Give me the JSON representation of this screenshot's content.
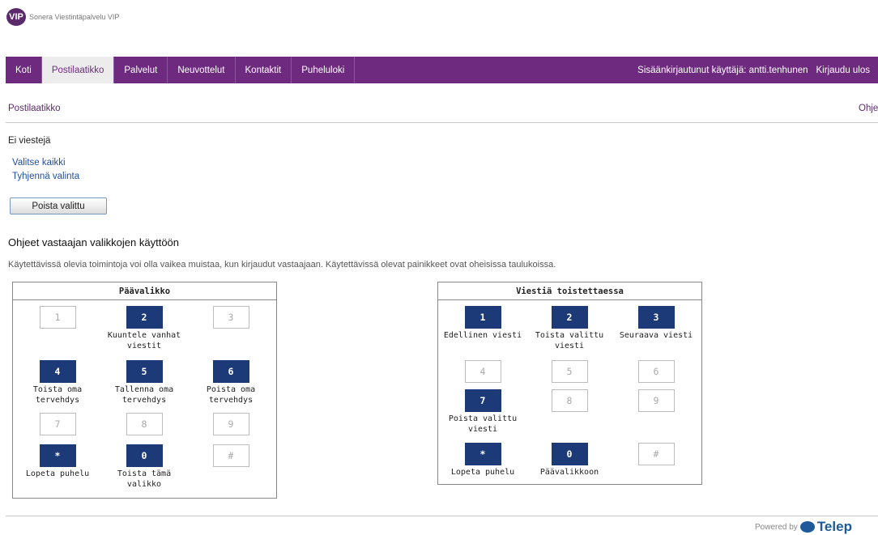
{
  "brand": {
    "logo": "VIP",
    "subtitle": "Sonera Viestintäpalvelu VIP"
  },
  "nav": {
    "items": [
      {
        "label": "Koti"
      },
      {
        "label": "Postilaatikko",
        "active": true
      },
      {
        "label": "Palvelut"
      },
      {
        "label": "Neuvottelut"
      },
      {
        "label": "Kontaktit"
      },
      {
        "label": "Puheluloki"
      }
    ],
    "logged_in": "Sisäänkirjautunut käyttäjä: antti.tenhunen",
    "logout": "Kirjaudu ulos"
  },
  "breadcrumb": "Postilaatikko",
  "help": "Ohje",
  "inbox": {
    "empty_text": "Ei viestejä",
    "select_all": "Valitse kaikki",
    "clear_selection": "Tyhjennä valinta",
    "delete_button": "Poista valittu"
  },
  "instructions": {
    "title": "Ohjeet vastaajan valikkojen käyttöön",
    "description": "Käytettävissä olevia toimintoja voi olla vaikea muistaa, kun kirjaudut vastaajaan. Käytettävissä olevat painikkeet ovat oheisissa taulukoissa."
  },
  "keypads": [
    {
      "title": "Päävalikko",
      "keys": [
        {
          "key": "1",
          "label": "",
          "active": false
        },
        {
          "key": "2",
          "label": "Kuuntele vanhat viestit",
          "active": true
        },
        {
          "key": "3",
          "label": "",
          "active": false
        },
        {
          "key": "4",
          "label": "Toista oma tervehdys",
          "active": true
        },
        {
          "key": "5",
          "label": "Tallenna oma tervehdys",
          "active": true
        },
        {
          "key": "6",
          "label": "Poista oma tervehdys",
          "active": true
        },
        {
          "key": "7",
          "label": "",
          "active": false
        },
        {
          "key": "8",
          "label": "",
          "active": false
        },
        {
          "key": "9",
          "label": "",
          "active": false
        },
        {
          "key": "*",
          "label": "Lopeta puhelu",
          "active": true
        },
        {
          "key": "0",
          "label": "Toista tämä valikko",
          "active": true
        },
        {
          "key": "#",
          "label": "",
          "active": false
        }
      ]
    },
    {
      "title": "Viestiä toistettaessa",
      "keys": [
        {
          "key": "1",
          "label": "Edellinen viesti",
          "active": true
        },
        {
          "key": "2",
          "label": "Toista valittu viesti",
          "active": true
        },
        {
          "key": "3",
          "label": "Seuraava viesti",
          "active": true
        },
        {
          "key": "4",
          "label": "",
          "active": false
        },
        {
          "key": "5",
          "label": "",
          "active": false
        },
        {
          "key": "6",
          "label": "",
          "active": false
        },
        {
          "key": "7",
          "label": "Poista valittu viesti",
          "active": true
        },
        {
          "key": "8",
          "label": "",
          "active": false
        },
        {
          "key": "9",
          "label": "",
          "active": false
        },
        {
          "key": "*",
          "label": "Lopeta puhelu",
          "active": true
        },
        {
          "key": "0",
          "label": "Päävalikkoon",
          "active": true
        },
        {
          "key": "#",
          "label": "",
          "active": false
        }
      ]
    }
  ],
  "footer": {
    "powered_by": "Powered by",
    "brand": "Telep"
  }
}
